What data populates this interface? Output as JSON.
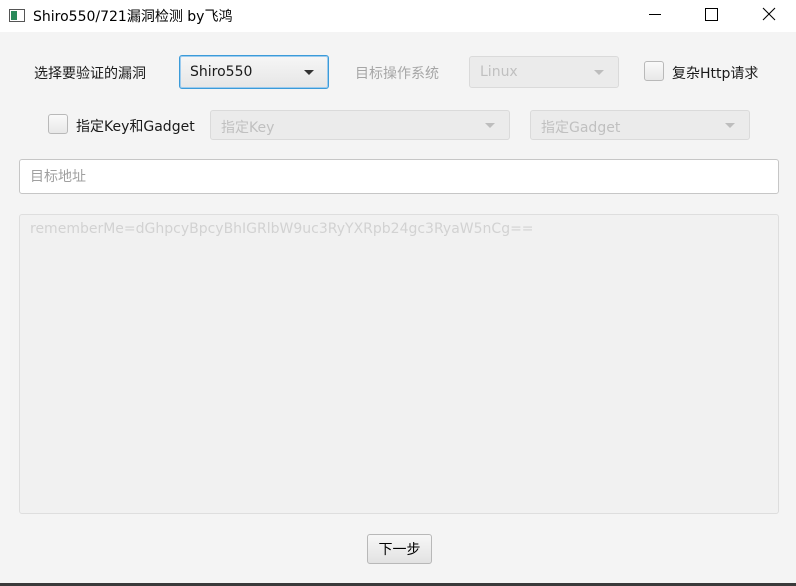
{
  "window": {
    "title": "Shiro550/721漏洞检测  by飞鸿"
  },
  "form": {
    "vuln_label": "选择要验证的漏洞",
    "vuln_value": "Shiro550",
    "os_label": "目标操作系统",
    "os_value": "Linux",
    "complex_http_label": "复杂Http请求",
    "complex_http_checked": false,
    "key_gadget_label": "指定Key和Gadget",
    "key_gadget_checked": false,
    "key_placeholder": "指定Key",
    "gadget_placeholder": "指定Gadget",
    "target_placeholder": "目标地址",
    "payload_placeholder": "rememberMe=dGhpcyBpcyBhIGRlbW9uc3RyYXRpb24gc3RyaW5nCg==",
    "next_button": "下一步"
  },
  "colors": {
    "focus_border": "#3b9bd9",
    "disabled_text": "#a6a6a6"
  }
}
